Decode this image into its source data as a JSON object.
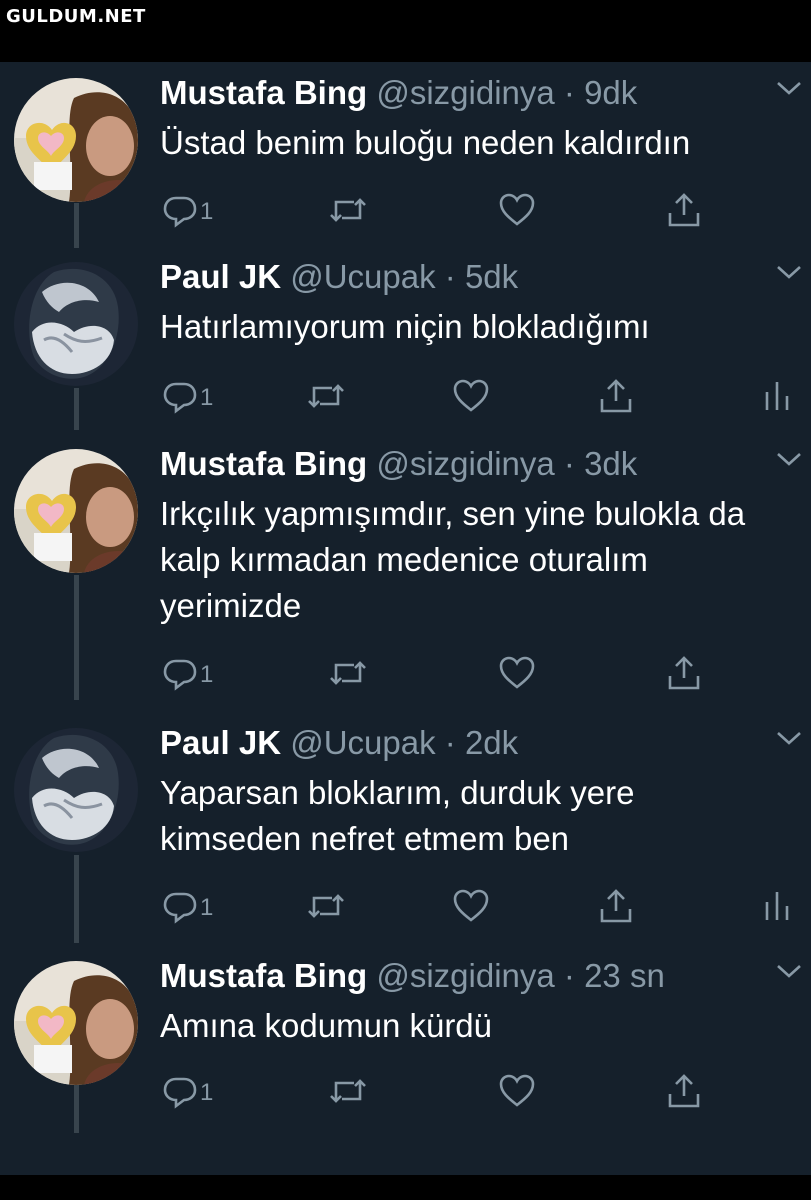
{
  "watermark": "GULDUM.NET",
  "tweets": [
    {
      "name": "Mustafa Bing",
      "handle": "@sizgidinya",
      "time": "9dk",
      "text": "Üstad benim buloğu neden kaldırdın",
      "reply_count": "1",
      "avatar": "mustafa",
      "analytics": false
    },
    {
      "name": "Paul JK",
      "handle": "@Ucupak",
      "time": "5dk",
      "text": "Hatırlamıyorum niçin blokladığımı",
      "reply_count": "1",
      "avatar": "paul",
      "analytics": true
    },
    {
      "name": "Mustafa Bing",
      "handle": "@sizgidinya",
      "time": "3dk",
      "text": "Irkçılık yapmışımdır, sen yine bulokla da kalp kırmadan medenice oturalım yerimizde",
      "reply_count": "1",
      "avatar": "mustafa",
      "analytics": false
    },
    {
      "name": "Paul JK",
      "handle": "@Ucupak",
      "time": "2dk",
      "text": "Yaparsan bloklarım, durduk yere kimseden nefret etmem ben",
      "reply_count": "1",
      "avatar": "paul",
      "analytics": true
    },
    {
      "name": "Mustafa Bing",
      "handle": "@sizgidinya",
      "time": "23 sn",
      "text": "Amına kodumun kürdü",
      "reply_count": "1",
      "avatar": "mustafa",
      "analytics": false
    }
  ],
  "icons": {
    "reply": "reply-icon",
    "retweet": "retweet-icon",
    "like": "like-icon",
    "share": "share-icon",
    "analytics": "analytics-icon",
    "caret": "chevron-down-icon"
  },
  "colors": {
    "background": "#15202b",
    "secondary_text": "#8899a6",
    "primary_text": "#ffffff",
    "thread_line": "#38444d"
  }
}
